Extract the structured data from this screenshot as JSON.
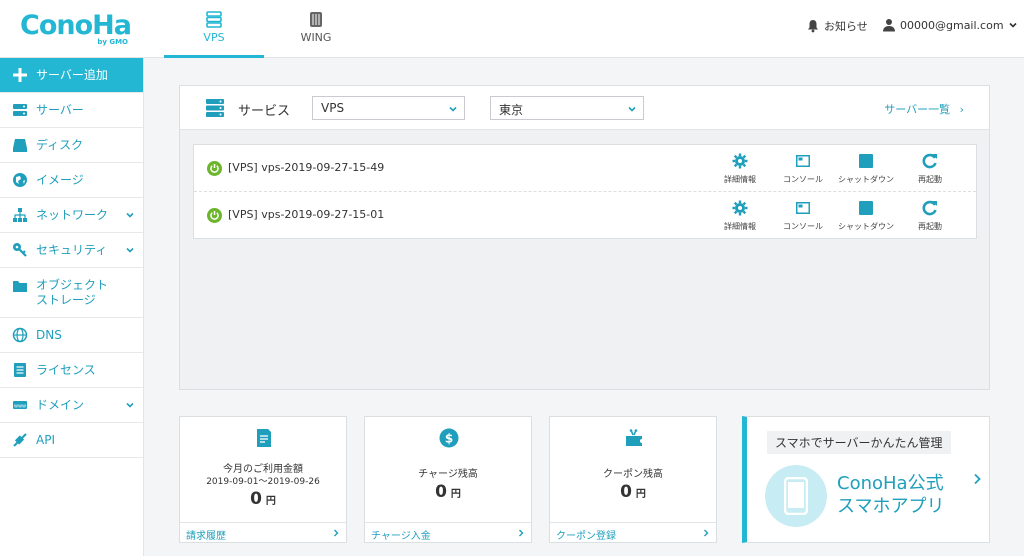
{
  "header": {
    "logo": "ConoHa",
    "logo_sub": "by GMO",
    "tabs": [
      {
        "label": "VPS",
        "icon": "server-stack-icon",
        "active": true
      },
      {
        "label": "WING",
        "icon": "wing-icon",
        "active": false
      }
    ],
    "notice_label": "お知らせ",
    "account_label": "00000@gmail.com"
  },
  "sidebar": {
    "items": [
      {
        "label": "サーバー追加",
        "icon": "plus-icon"
      },
      {
        "label": "サーバー",
        "icon": "server-icon"
      },
      {
        "label": "ディスク",
        "icon": "disk-icon"
      },
      {
        "label": "イメージ",
        "icon": "globe-image-icon"
      },
      {
        "label": "ネットワーク",
        "icon": "network-icon"
      },
      {
        "label": "セキュリティ",
        "icon": "key-icon"
      },
      {
        "label": "オブジェクト",
        "label2": "ストレージ",
        "icon": "folder-icon"
      },
      {
        "label": "DNS",
        "icon": "dns-globe-icon"
      },
      {
        "label": "ライセンス",
        "icon": "license-icon"
      },
      {
        "label": "ドメイン",
        "icon": "domain-icon"
      },
      {
        "label": "API",
        "icon": "api-icon"
      }
    ]
  },
  "services": {
    "title": "サービス",
    "type_select": "VPS",
    "region_select": "東京",
    "list_link": "サーバー一覧",
    "servers": [
      {
        "name": "[VPS] vps-2019-09-27-15-49",
        "status": "running"
      },
      {
        "name": "[VPS] vps-2019-09-27-15-01",
        "status": "running"
      }
    ],
    "actions": {
      "details": "詳細情報",
      "console": "コンソール",
      "shutdown": "シャットダウン",
      "restart": "再起動"
    }
  },
  "cards": {
    "usage": {
      "title": "今月のご利用金額",
      "period": "2019-09-01〜2019-09-26",
      "amount": "0",
      "unit": "円",
      "link": "請求履歴"
    },
    "charge": {
      "title": "チャージ残高",
      "amount": "0",
      "unit": "円",
      "link": "チャージ入金"
    },
    "coupon": {
      "title": "クーポン残高",
      "amount": "0",
      "unit": "円",
      "link": "クーポン登録"
    }
  },
  "promo": {
    "tag": "スマホでサーバーかんたん管理",
    "line1": "ConoHa公式",
    "line2": "スマホアプリ"
  },
  "colors": {
    "accent": "#23b7d3",
    "link": "#1f9fbc",
    "power_on": "#6cb52d"
  }
}
